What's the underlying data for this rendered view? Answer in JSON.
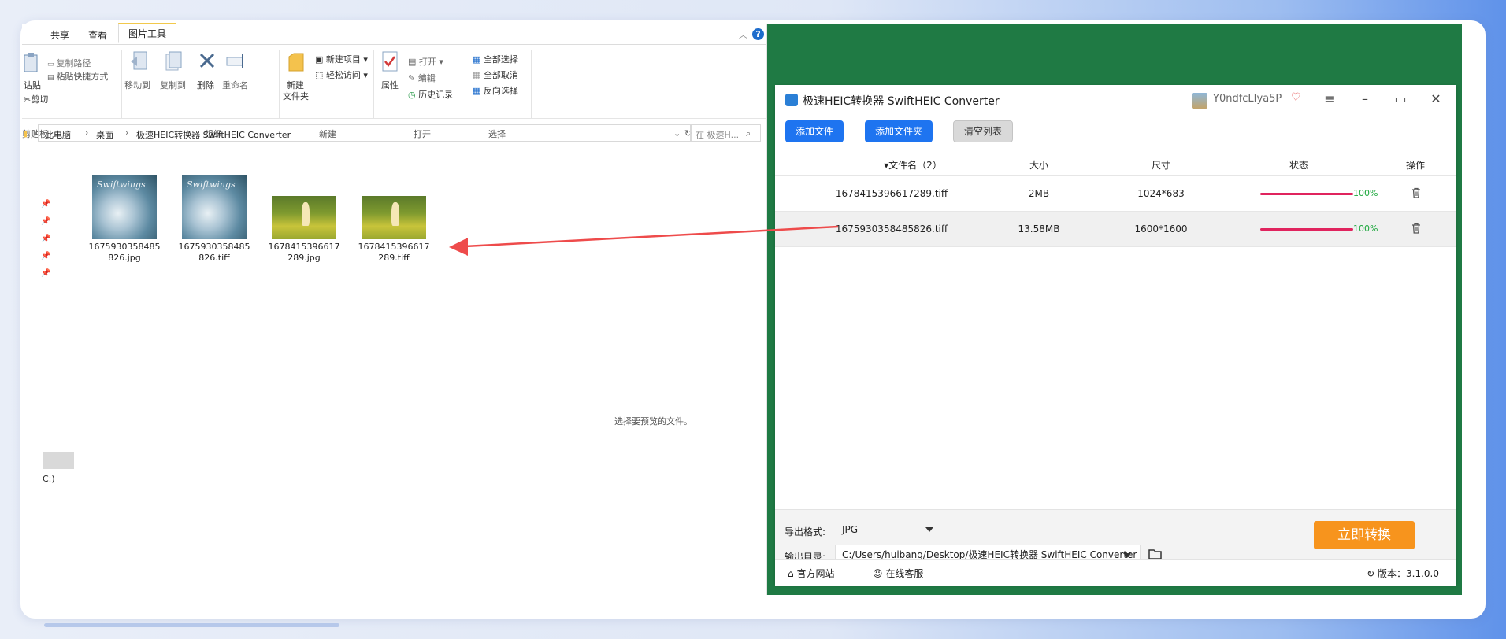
{
  "explorer": {
    "ribbon_tabs": [
      "共享",
      "查看",
      "图片工具"
    ],
    "clipboard": {
      "paste_partial": "诂贴",
      "copy_path": "复制路径",
      "paste_shortcut": "粘贴快捷方式",
      "cut": "剪切",
      "group": "剪贴板"
    },
    "organize": {
      "move_to": "移动到",
      "copy_to": "复制到",
      "delete": "删除",
      "rename": "重命名",
      "group": "组织"
    },
    "new": {
      "new_folder_line1": "新建",
      "new_folder_line2": "文件夹",
      "new_item": "新建项目",
      "easy_access": "轻松访问",
      "group": "新建"
    },
    "open": {
      "properties": "属性",
      "open": "打开",
      "edit": "编辑",
      "history": "历史记录",
      "group": "打开"
    },
    "select": {
      "select_all": "全部选择",
      "select_none": "全部取消",
      "invert": "反向选择",
      "group": "选择"
    },
    "address": {
      "crumbs": [
        "此电脑",
        "桌面",
        "极速HEIC转换器 SwiftHEIC Converter"
      ],
      "search_placeholder": "在 极速H..."
    },
    "files": [
      {
        "line1": "1675930358485",
        "line2": "826.jpg",
        "overlay": "Swiftwings"
      },
      {
        "line1": "1675930358485",
        "line2": "826.tiff",
        "overlay": "Swiftwings"
      },
      {
        "line1": "1678415396617",
        "line2": "289.jpg"
      },
      {
        "line1": "1678415396617",
        "line2": "289.tiff"
      }
    ],
    "preview_hint": "选择要预览的文件。",
    "drive_label": "C:)"
  },
  "app": {
    "title": "极速HEIC转换器 SwiftHEIC Converter",
    "username": "Y0ndfcLIya5P",
    "buttons": {
      "add_file": "添加文件",
      "add_folder": "添加文件夹",
      "clear_list": "清空列表"
    },
    "columns": {
      "name": "▾文件名（2）",
      "size": "大小",
      "dimensions": "尺寸",
      "status": "状态",
      "actions": "操作"
    },
    "rows": [
      {
        "name": "1678415396617289.tiff",
        "size": "2MB",
        "dims": "1024*683",
        "progress": "100%"
      },
      {
        "name": "1675930358485826.tiff",
        "size": "13.58MB",
        "dims": "1600*1600",
        "progress": "100%"
      }
    ],
    "export_format_label": "导出格式:",
    "export_format_value": "JPG",
    "output_dir_label": "输出目录:",
    "output_dir_value": "C:/Users/huibang/Desktop/极速HEIC转换器 SwiftHEIC Converter",
    "convert_button": "立即转换",
    "footer": {
      "website": "官方网站",
      "support": "在线客服",
      "version": "版本：3.1.0.0"
    },
    "colors": {
      "accent": "#1e74f0",
      "convert": "#f7941d",
      "progress": "#e0245e",
      "done": "#1aa73b"
    }
  }
}
